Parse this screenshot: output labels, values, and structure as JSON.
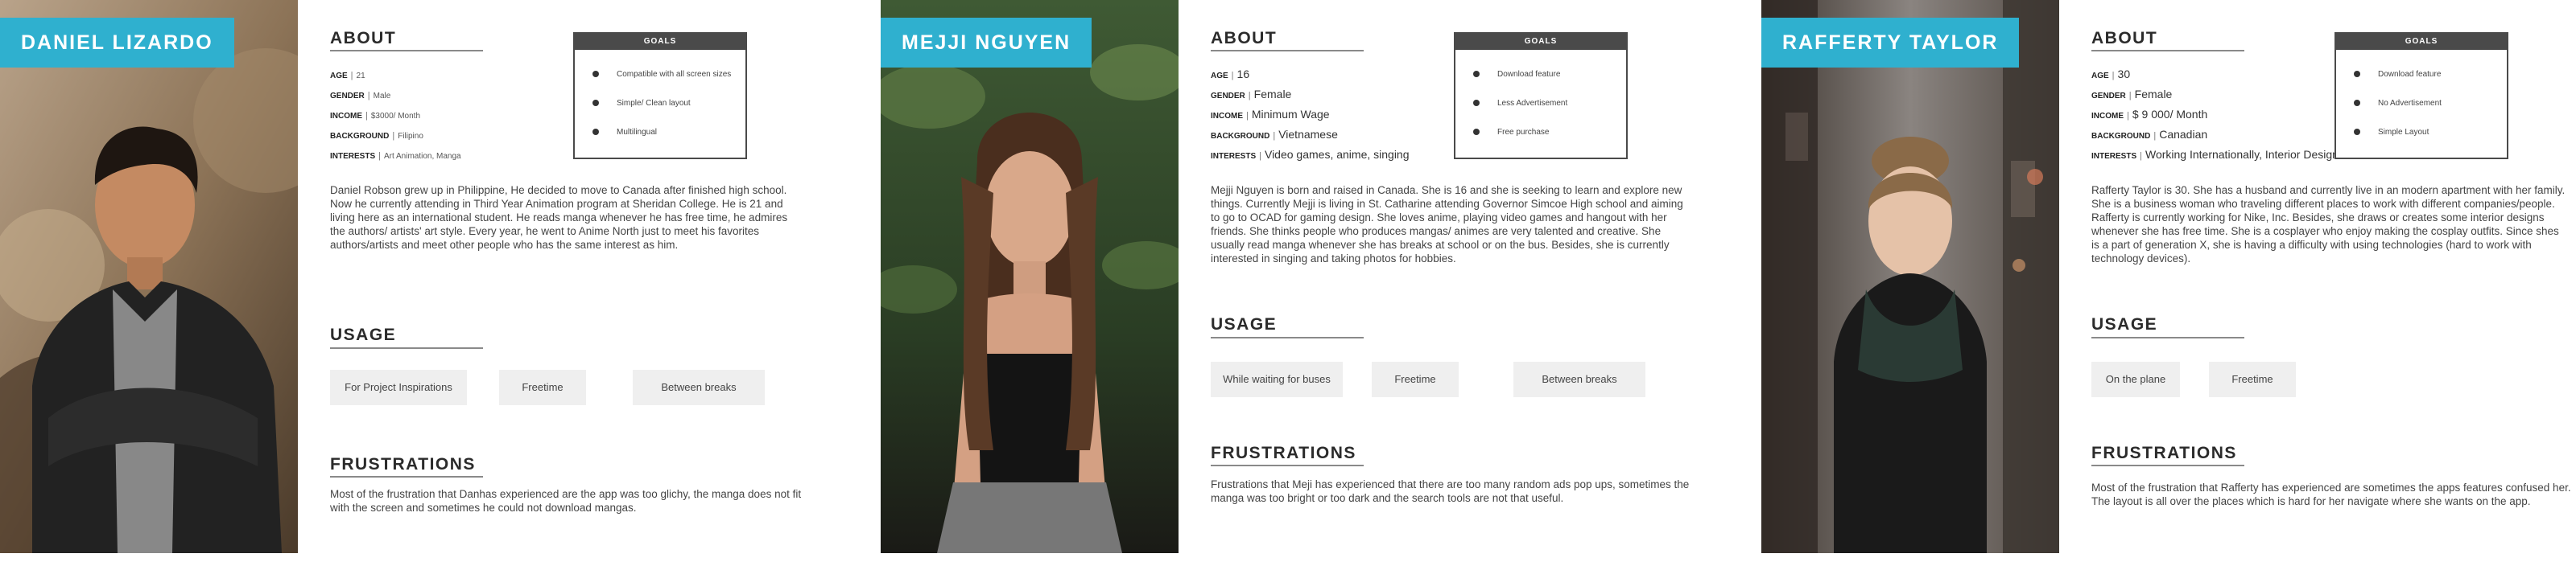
{
  "labels": {
    "about": "ABOUT",
    "goals": "GOALS",
    "usage": "USAGE",
    "frustrations": "FRUSTRATIONS",
    "age": "AGE",
    "gender": "GENDER",
    "income": "INCOME",
    "background": "BACKGROUND",
    "interests": "INTERESTS"
  },
  "personas": [
    {
      "name": "DANIEL LIZARDO",
      "age": "21",
      "gender": "Male",
      "income": "$3000/ Month",
      "background": "Filipino",
      "interests": "Art Animation, Manga",
      "goals": [
        "Compatible with all screen sizes",
        "Simple/ Clean layout",
        "Multilingual"
      ],
      "bio": "Daniel Robson grew up in Philippine, He decided to move to Canada after finished high school. Now he currently attending in Third Year Animation program at Sheridan College. He is 21 and living here as an international student. He reads manga whenever he has free time, he admires the authors/ artists' art style. Every year, he went to Anime North  just to meet his favorites authors/artists and meet other people who has the same interest as him.",
      "usage": [
        "For Project Inspirations",
        "Freetime",
        "Between breaks"
      ],
      "frustrations": "Most of the frustration that Danhas experienced are the app was too glichy, the manga does not fit with the screen and sometimes he could not download mangas."
    },
    {
      "name": "MEJJI NGUYEN",
      "age": "16",
      "gender": "Female",
      "income": "Minimum Wage",
      "background": "Vietnamese",
      "interests": "Video games, anime, singing",
      "goals": [
        "Download feature",
        "Less Advertisement",
        "Free purchase"
      ],
      "bio": "Mejji Nguyen is born and raised in Canada. She is 16 and she is seeking to learn and explore new things. Currently Mejji is living in St. Catharine attending Governor Simcoe High school and aiming to go to OCAD for gaming design. She loves anime, playing video games and hangout with her friends. She thinks people who produces mangas/ animes are very talented and creative. She usually read manga whenever she has breaks at school or on the bus. Besides, she is currently interested in singing and taking photos for hobbies.",
      "usage": [
        "While waiting for buses",
        "Freetime",
        "Between breaks"
      ],
      "frustrations": "Frustrations that Meji has experienced that there are too many random ads pop ups, sometimes the manga was too bright or too dark and the search tools are not that useful."
    },
    {
      "name": "RAFFERTY TAYLOR",
      "age": "30",
      "gender": "Female",
      "income": "$ 9 000/ Month",
      "background": "Canadian",
      "interests": "Working Internationally, Interior Design",
      "goals": [
        "Download feature",
        "No Advertisement",
        "Simple Layout"
      ],
      "bio": "Rafferty Taylor is 30. She has a husband and currently live in an modern apartment with her family. She is a business woman who traveling different places to work with different companies/people. Rafferty is currently working for Nike, Inc. Besides, she draws or creates some interior designs whenever she has free time. She is a cosplayer who enjoy making the cosplay outfits. Since shes is a part of generation X, she is having a difficulty with using technologies (hard to work with technology devices).",
      "usage": [
        "On the plane",
        "Freetime"
      ],
      "frustrations": "Most of the frustration that Rafferty has experienced are sometimes the apps features confused her. The layout is all over the places which is hard for her navigate where she wants on the app."
    }
  ]
}
